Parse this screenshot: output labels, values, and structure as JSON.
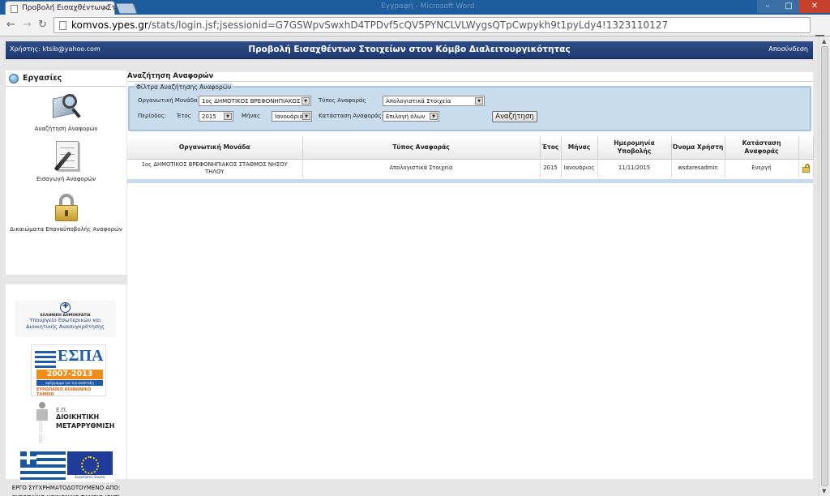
{
  "browser": {
    "tab_title": "Προβολή Εισαχθέντων Στ",
    "background_title": "Εγγραφή - Microsoft Word",
    "url_host": "komvos.ypes.gr",
    "url_path": "/stats/login.jsf;jsessionid=G7GSWpvSwxhD4TPDvf5cQV5PYNCLVLWygsQTpCwpykh9t1pyLdy4!1323110127"
  },
  "header": {
    "user": "Χρήστης: ktsib@yahoo.com",
    "title": "Προβολή Εισαχθέντων Στοιχείων στον Κόμβο Διαλειτουργικότητας",
    "logout": "Αποσύνδεση"
  },
  "sidebar": {
    "title": "Εργασίες",
    "items": [
      {
        "label": "Αναζήτηση Αναφορών",
        "icon": "search-reports-icon"
      },
      {
        "label": "Εισαγωγή Αναφορών",
        "icon": "edit-document-icon"
      },
      {
        "label": "Δικαιώματα Επαναϋποβολής Αναφορών",
        "icon": "padlock-icon"
      }
    ],
    "logos": {
      "ministry_header": "ΕΛΛΗΝΙΚΗ ΔΗΜΟΚΡΑΤΙΑ",
      "ministry_name": "Υπουργείο Εσωτερικών και Διοικητικής Ανασυγκρότησης",
      "espa_word": "ΕΣΠΑ",
      "espa_years": "2007-2013",
      "espa_sub": "πρόγραμμα για την ανάπτυξη",
      "espa_fund": "ΕΥΡΩΠΑΪΚΟ ΚΟΙΝΩΝΙΚΟ ΤΑΜΕΙΟ",
      "admin_prefix": "Ε.Π.",
      "admin_line1": "ΔΙΟΙΚΗΤΙΚΗ",
      "admin_line2": "ΜΕΤΑΡΡΥΘΜΙΣΗ",
      "admin_years": "2007-2013",
      "eu_band": "Ευρωπαϊκή Ένωση"
    },
    "funding_text": "ΕΡΓΟ ΣΥΓΧΡΗΜΑΤΟΔΟΤΟΥΜΕΝΟ ΑΠΟ: ΕΥΡΩΠΑΪΚΟ ΚΟΙΝΩΝΙΚΟ ΤΑΜΕΙΟ (ΕΚΤ)"
  },
  "main": {
    "title": "Αναζήτηση Αναφορών",
    "filters": {
      "legend": "Φίλτρα Αναζήτησης Αναφορών",
      "org_unit_label": "Οργανωτική Μονάδα",
      "org_unit_value": "1ος ΔΗΜΟΤΙΚΟΣ ΒΡΕΦΟΝΗΠΙΑΚΟΣ",
      "report_type_label": "Τύπος Αναφοράς",
      "report_type_value": "Απολογιστικά Στοιχεία",
      "period_label": "Περίοδος:",
      "year_label": "Έτος",
      "year_value": "2015",
      "month_label": "Μήνας",
      "month_value": "Ιανουάριος",
      "status_label": "Κατάσταση Αναφοράς:",
      "status_value": "Επιλογή όλων",
      "search_button": "Αναζήτηση"
    },
    "table": {
      "columns": [
        "Οργανωτική Μονάδα",
        "Τύπος Αναφοράς",
        "Έτος",
        "Μήνας",
        "Ημερομηνία Υποβολής",
        "Όνομα Χρήστη",
        "Κατάσταση Αναφοράς",
        ""
      ],
      "rows": [
        [
          "1ος ΔΗΜΟΤΙΚΟΣ ΒΡΕΦΟΝΗΠΙΑΚΟΣ ΣΤΑΘΜΟΣ ΝΗΣΟΥ ΤΗΛΟΥ",
          "Απολογιστικά Στοιχεία",
          "2015",
          "Ιανουάριος",
          "11/11/2015",
          "wsdaresadmin",
          "Ενεργή",
          "unlock-icon"
        ]
      ]
    }
  }
}
